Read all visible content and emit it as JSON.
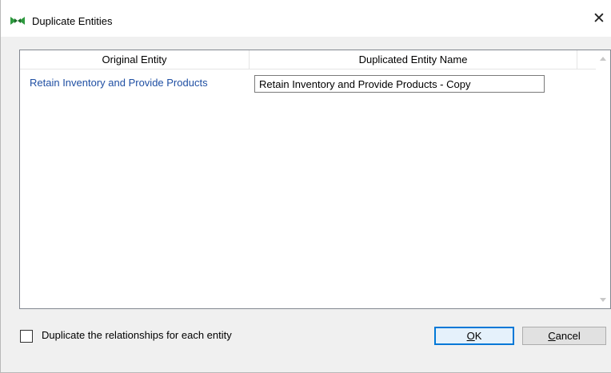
{
  "window": {
    "title": "Duplicate Entities",
    "app_icon": "entities-icon",
    "close_icon": "close-icon",
    "close_glyph": "✕"
  },
  "grid": {
    "columns": [
      "Original Entity",
      "Duplicated Entity Name",
      ""
    ],
    "rows": [
      {
        "original": "Retain Inventory and Provide Products",
        "duplicated_name": "Retain Inventory and Provide Products - Copy"
      }
    ]
  },
  "options": {
    "duplicate_relationships_label": "Duplicate the relationships for each entity",
    "duplicate_relationships_checked": false
  },
  "buttons": {
    "ok_prefix": "",
    "ok_mnemonic": "O",
    "ok_rest": "K",
    "cancel_mnemonic": "C",
    "cancel_rest": "ancel"
  },
  "colors": {
    "link_blue": "#1f4fa3",
    "focus_blue": "#0078d7"
  }
}
